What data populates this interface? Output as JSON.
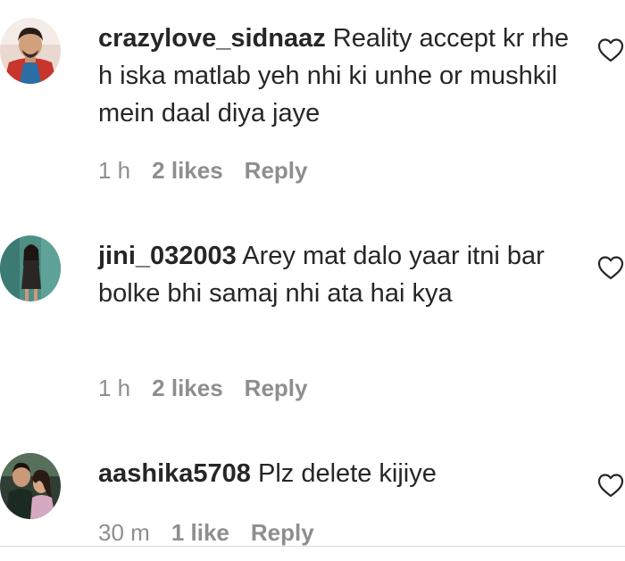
{
  "comments": [
    {
      "username": "crazylove_sidnaaz",
      "text": "Reality accept kr rhe h iska matlab yeh nhi ki unhe or mushkil mein daal diya jaye",
      "time": "1 h",
      "likes": "2 likes",
      "reply": "Reply",
      "avatar_icon": "avatar-man-red-jacket",
      "like_icon": "heart-outline-icon"
    },
    {
      "username": "jini_032003",
      "text": "Arey mat dalo yaar itni bar bolke bhi samaj nhi ata hai kya",
      "time": "1 h",
      "likes": "2 likes",
      "reply": "Reply",
      "avatar_icon": "avatar-woman-dark-dress",
      "like_icon": "heart-outline-icon"
    },
    {
      "username": "aashika5708",
      "text": "Plz delete kijiye",
      "time": "30 m",
      "likes": "1 like",
      "reply": "Reply",
      "avatar_icon": "avatar-couple",
      "like_icon": "heart-outline-icon"
    }
  ],
  "colors": {
    "text": "#262626",
    "meta": "#8e8e8e",
    "divider": "#dbdbdb"
  }
}
